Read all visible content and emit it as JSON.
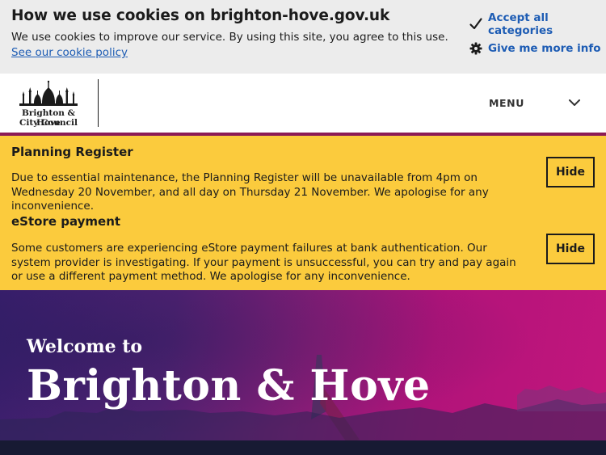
{
  "cookie_banner": {
    "title": "How we use cookies on brighton-hove.gov.uk",
    "text": "We use cookies to improve our service. By using this site, you agree to this use.",
    "policy_link": "See our cookie policy",
    "accept_label": "Accept all categories",
    "more_info_label": "Give me more info"
  },
  "header": {
    "logo_line1": "Brighton & Hove",
    "logo_line2": "City Council",
    "menu_label": "MENU"
  },
  "alerts": [
    {
      "title": "Planning Register",
      "body": "Due to essential maintenance, the Planning Register will be unavailable from 4pm on Wednesday 20 November, and all day on Thursday 21 November. We apologise for any inconvenience.",
      "hide_label": "Hide"
    },
    {
      "title": "eStore payment",
      "body": "Some customers are experiencing eStore payment failures at bank authentication. Our system provider is investigating. If your payment is unsuccessful, you can try and pay again or use a different payment method. We apologise for any inconvenience.",
      "hide_label": "Hide"
    }
  ],
  "hero": {
    "welcome": "Welcome to",
    "title": "Brighton & Hove"
  },
  "colors": {
    "link": "#1d5cb4",
    "alert_bg": "#fbcb3d",
    "brand_bar": "#8c1a55"
  },
  "icons": {
    "accept": "checkmark-icon",
    "more_info": "gear-icon",
    "menu": "chevron-down-icon",
    "logo": "royal-pavilion-logo"
  }
}
